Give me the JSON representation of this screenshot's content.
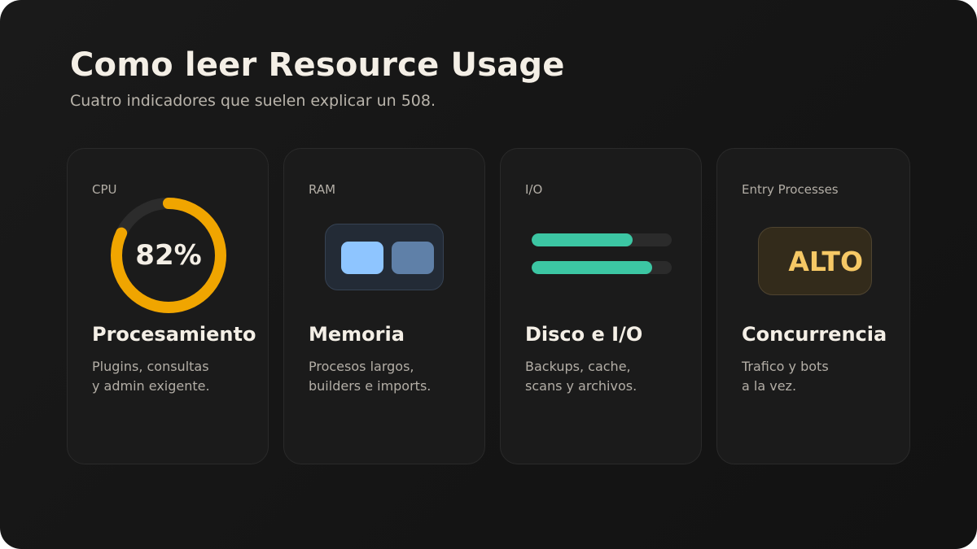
{
  "header": {
    "title": "Como leer Resource Usage",
    "subtitle": "Cuatro indicadores que suelen explicar un 508."
  },
  "colors": {
    "cpu_ring": "#f0a500",
    "ring_track": "#2c2c2c",
    "ram_chip_light": "#8ec5ff",
    "ram_chip_dark": "#5f80a8",
    "io_bar": "#3cc6a3",
    "badge_text": "#f6c865"
  },
  "cards": [
    {
      "label": "CPU",
      "indicator": {
        "kind": "donut",
        "value_text": "82%",
        "fraction": 0.82
      },
      "title": "Procesamiento",
      "desc": [
        "Plugins, consultas",
        "y admin exigente."
      ]
    },
    {
      "label": "RAM",
      "indicator": {
        "kind": "memory-module-icon"
      },
      "title": "Memoria",
      "desc": [
        "Procesos largos,",
        "builders e imports."
      ]
    },
    {
      "label": "I/O",
      "indicator": {
        "kind": "bars",
        "levels": [
          0.72,
          0.86
        ]
      },
      "title": "Disco e I/O",
      "desc": [
        "Backups, cache,",
        "scans y archivos."
      ]
    },
    {
      "label": "Entry Processes",
      "indicator": {
        "kind": "badge",
        "text": "ALTO"
      },
      "title": "Concurrencia",
      "desc": [
        "Trafico y bots",
        "a la vez."
      ]
    }
  ]
}
